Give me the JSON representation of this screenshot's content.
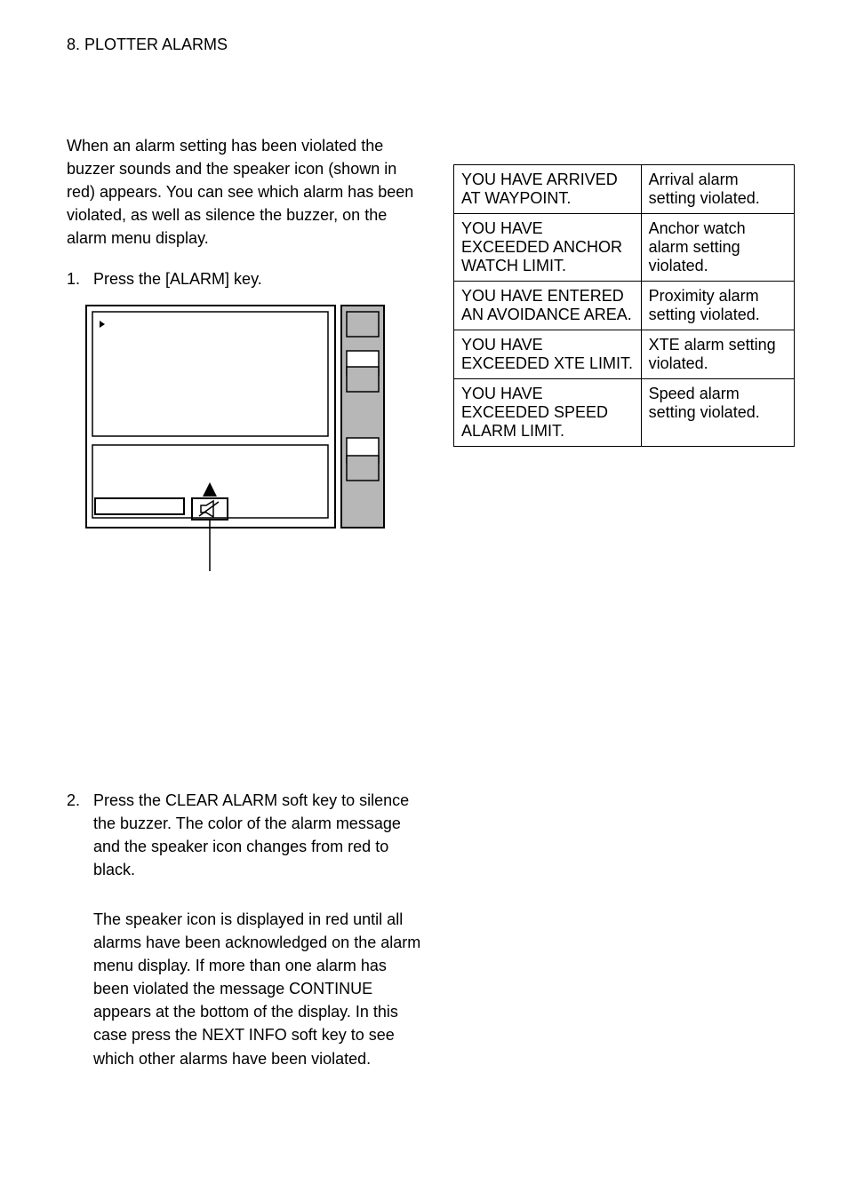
{
  "header": "8. PLOTTER ALARMS",
  "intro": "When an alarm setting has been violated the buzzer sounds and the speaker icon (shown in red) appears. You can see which alarm has been violated, as well as silence the buzzer, on the alarm menu display.",
  "step1_num": "1.",
  "step1_text": "Press the [ALARM] key.",
  "step2_num": "2.",
  "step2_text": "Press the CLEAR ALARM soft key to silence the buzzer. The color of the alarm message and the speaker icon changes from red to black.",
  "note": "The speaker icon is displayed in red until all alarms have been acknowledged on the alarm menu display. If more than one alarm has been violated the message CONTINUE appears at the bottom of the display. In this case press the NEXT INFO soft key to see which other alarms have been violated.",
  "table": {
    "rows": [
      {
        "msg": "YOU HAVE ARRIVED AT WAYPOINT.",
        "meaning": "Arrival alarm setting violated."
      },
      {
        "msg": "YOU HAVE EXCEEDED ANCHOR WATCH LIMIT.",
        "meaning": "Anchor watch alarm setting violated."
      },
      {
        "msg": "YOU HAVE ENTERED AN AVOIDANCE AREA.",
        "meaning": "Proximity alarm setting violated."
      },
      {
        "msg": "YOU HAVE EXCEEDED XTE LIMIT.",
        "meaning": "XTE alarm setting violated."
      },
      {
        "msg": "YOU HAVE EXCEEDED SPEED ALARM LIMIT.",
        "meaning": "Speed alarm setting violated."
      }
    ]
  }
}
